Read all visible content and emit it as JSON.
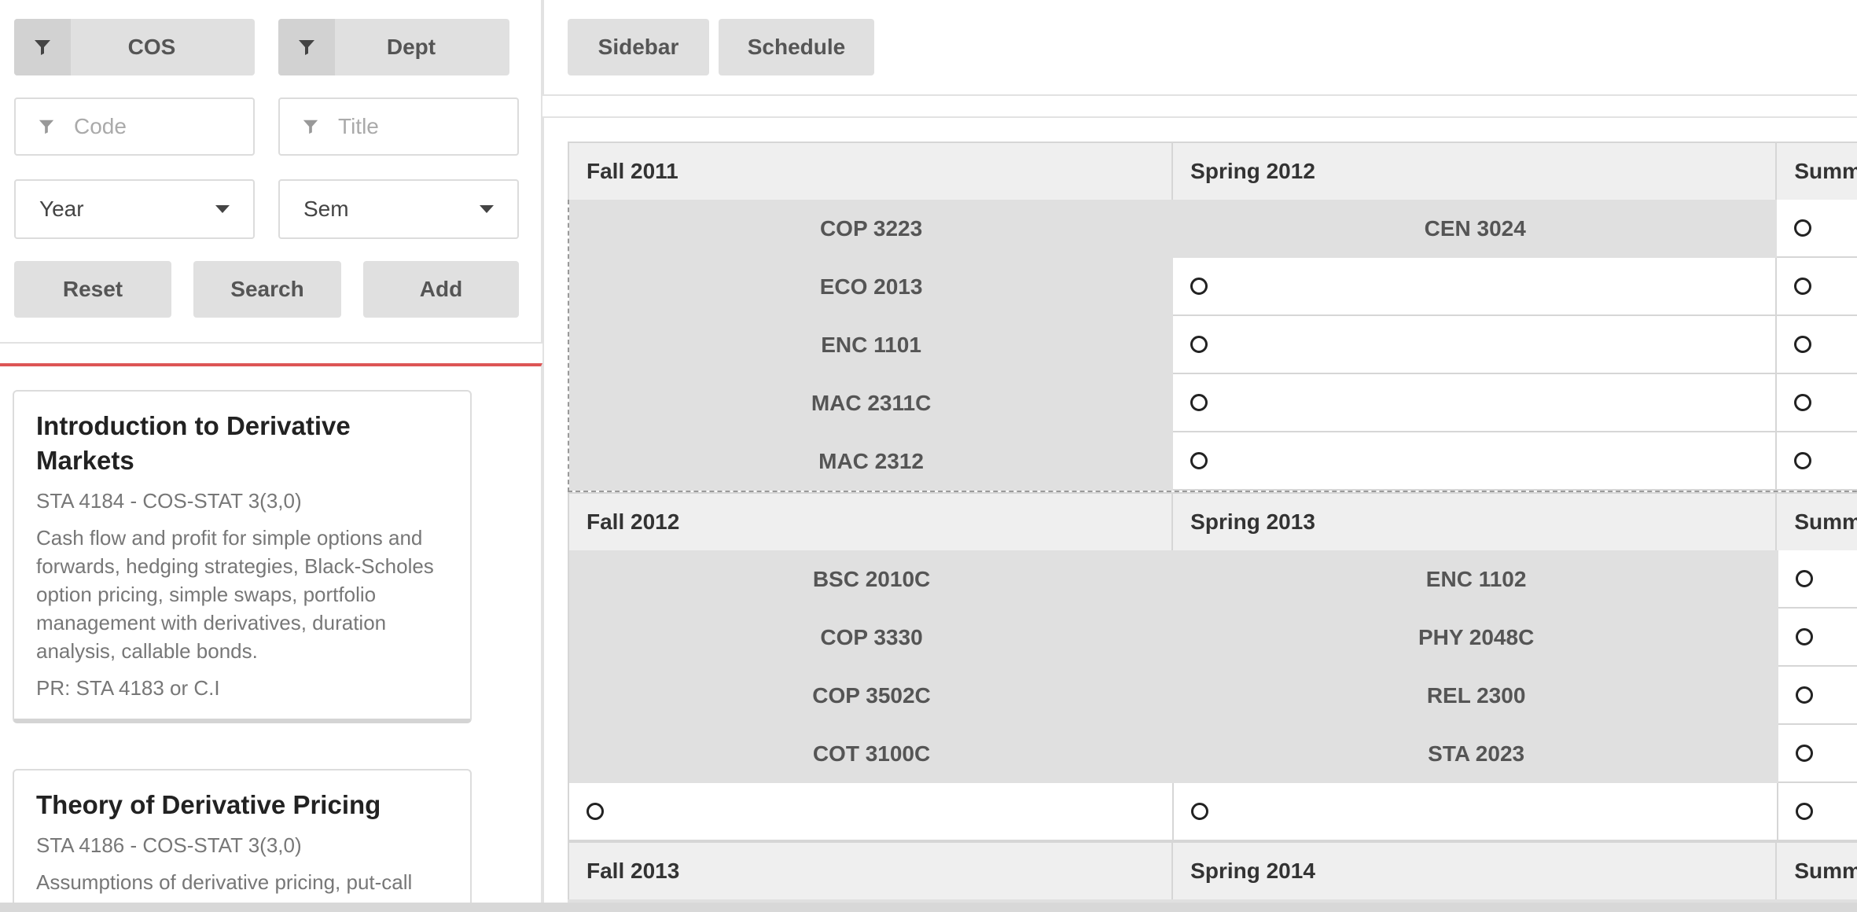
{
  "filters": {
    "cos_label": "COS",
    "dept_label": "Dept",
    "code_placeholder": "Code",
    "title_placeholder": "Title",
    "year_label": "Year",
    "sem_label": "Sem",
    "reset_label": "Reset",
    "search_label": "Search",
    "add_label": "Add"
  },
  "topbar": {
    "sidebar_label": "Sidebar",
    "schedule_label": "Schedule"
  },
  "results": [
    {
      "title": "Introduction to Derivative Markets",
      "meta": "STA 4184 - COS-STAT 3(3,0)",
      "description": "Cash flow and profit for simple options and forwards, hedging strategies, Black-Scholes option pricing, simple swaps, portfolio management with derivatives, duration analysis, callable bonds.",
      "prereq": "PR: STA 4183 or C.I"
    },
    {
      "title": "Theory of Derivative Pricing",
      "meta": "STA 4186 - COS-STAT 3(3,0)",
      "description": "Assumptions of derivative pricing, put-call"
    }
  ],
  "schedule": {
    "years": [
      {
        "terms": [
          "Fall 2011",
          "Spring 2012",
          "Summ"
        ],
        "fall": [
          "COP 3223",
          "ECO 2013",
          "ENC 1101",
          "MAC 2311C",
          "MAC 2312"
        ],
        "spring": [
          "CEN 3024"
        ]
      },
      {
        "terms": [
          "Fall 2012",
          "Spring 2013",
          "Summ"
        ],
        "fall": [
          "BSC 2010C",
          "COP 3330",
          "COP 3502C",
          "COT 3100C"
        ],
        "spring": [
          "ENC 1102",
          "PHY 2048C",
          "REL 2300",
          "STA 2023"
        ]
      },
      {
        "terms": [
          "Fall 2013",
          "Spring 2014",
          "Summ"
        ]
      }
    ]
  }
}
